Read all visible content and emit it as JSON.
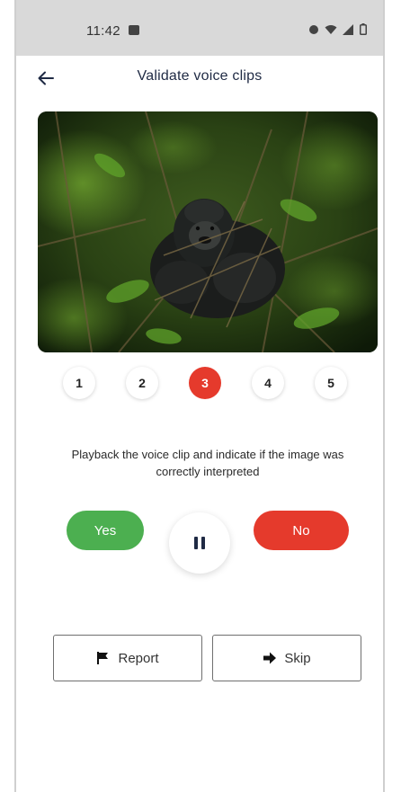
{
  "status_bar": {
    "time": "11:42",
    "icons": [
      "gallery-icon",
      "record-icon",
      "wifi-icon",
      "signal-icon",
      "battery-icon"
    ]
  },
  "header": {
    "title": "Validate voice clips",
    "back_icon": "back-arrow-icon"
  },
  "photo": {
    "subject": "gorilla-photo"
  },
  "steps": {
    "items": [
      "1",
      "2",
      "3",
      "4",
      "5"
    ],
    "active_index": 2
  },
  "instruction": {
    "text": "Playback the voice clip and indicate if the image was correctly interpreted"
  },
  "actions": {
    "yes_label": "Yes",
    "no_label": "No",
    "pause_icon": "pause-icon"
  },
  "footer": {
    "report_label": "Report",
    "report_icon": "flag-icon",
    "skip_label": "Skip",
    "skip_icon": "arrow-right-icon"
  },
  "colors": {
    "accent_red": "#e53a2c",
    "accent_green": "#4caf50",
    "title_color": "#1f2a44"
  }
}
